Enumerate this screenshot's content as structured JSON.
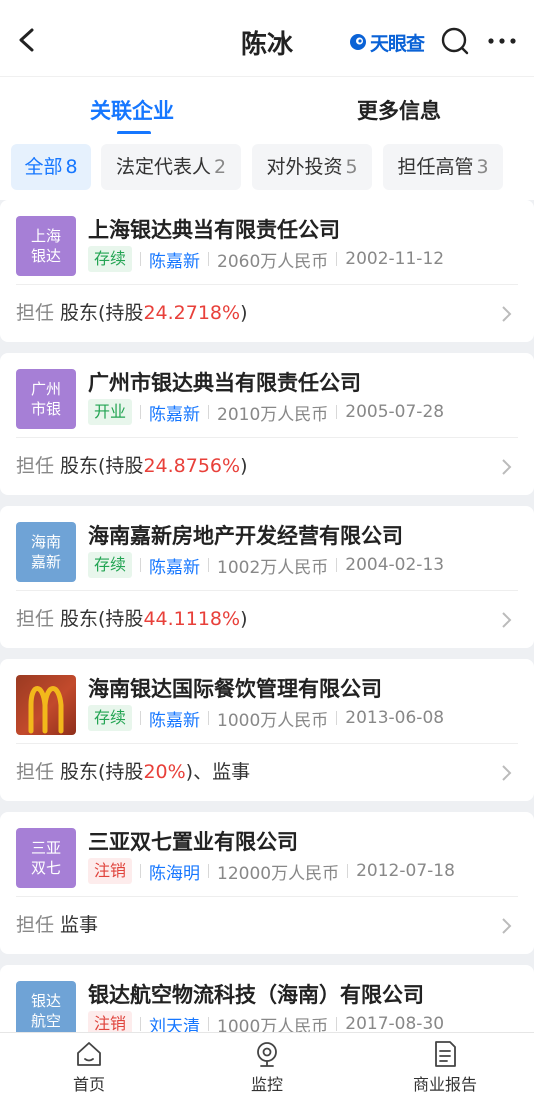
{
  "header": {
    "title": "陈冰",
    "brand": "天眼查"
  },
  "tabs": [
    {
      "label": "关联企业",
      "active": true
    },
    {
      "label": "更多信息",
      "active": false
    }
  ],
  "filters": [
    {
      "label": "全部",
      "count": "8",
      "active": true
    },
    {
      "label": "法定代表人",
      "count": "2",
      "active": false
    },
    {
      "label": "对外投资",
      "count": "5",
      "active": false
    },
    {
      "label": "担任高管",
      "count": "3",
      "active": false
    }
  ],
  "role_label": "担任",
  "companies": [
    {
      "badge1": "上海",
      "badge2": "银达",
      "badge_color": "#a67fd6",
      "name": "上海银达典当有限责任公司",
      "status": "存续",
      "status_type": "green",
      "person": "陈嘉新",
      "capital": "2060万人民币",
      "date": "2002-11-12",
      "role_pre": "股东(持股",
      "role_pct": "24.2718%",
      "role_post": ")"
    },
    {
      "badge1": "广州",
      "badge2": "市银",
      "badge_color": "#a67fd6",
      "name": "广州市银达典当有限责任公司",
      "status": "开业",
      "status_type": "green",
      "person": "陈嘉新",
      "capital": "2010万人民币",
      "date": "2005-07-28",
      "role_pre": "股东(持股",
      "role_pct": "24.8756%",
      "role_post": ")"
    },
    {
      "badge1": "海南",
      "badge2": "嘉新",
      "badge_color": "#6fa3d6",
      "name": "海南嘉新房地产开发经营有限公司",
      "status": "存续",
      "status_type": "green",
      "person": "陈嘉新",
      "capital": "1002万人民币",
      "date": "2004-02-13",
      "role_pre": "股东(持股",
      "role_pct": "44.1118%",
      "role_post": ")"
    },
    {
      "badge1": "",
      "badge2": "",
      "badge_color": "",
      "name": "海南银达国际餐饮管理有限公司",
      "status": "存续",
      "status_type": "green",
      "person": "陈嘉新",
      "capital": "1000万人民币",
      "date": "2013-06-08",
      "role_pre": "股东(持股",
      "role_pct": "20%",
      "role_post": ")、监事"
    },
    {
      "badge1": "三亚",
      "badge2": "双七",
      "badge_color": "#a67fd6",
      "name": "三亚双七置业有限公司",
      "status": "注销",
      "status_type": "red",
      "person": "陈海明",
      "capital": "12000万人民币",
      "date": "2012-07-18",
      "role_pre": "监事",
      "role_pct": "",
      "role_post": ""
    },
    {
      "badge1": "银达",
      "badge2": "航空",
      "badge_color": "#6fa3d6",
      "name": "银达航空物流科技（海南）有限公司",
      "status": "注销",
      "status_type": "red",
      "person": "刘天清",
      "capital": "1000万人民币",
      "date": "2017-08-30",
      "role_pre": "",
      "role_pct": "",
      "role_post": ""
    }
  ],
  "bottom_nav": [
    {
      "label": "首页",
      "icon": "home-icon"
    },
    {
      "label": "监控",
      "icon": "monitor-icon"
    },
    {
      "label": "商业报告",
      "icon": "report-icon"
    }
  ]
}
